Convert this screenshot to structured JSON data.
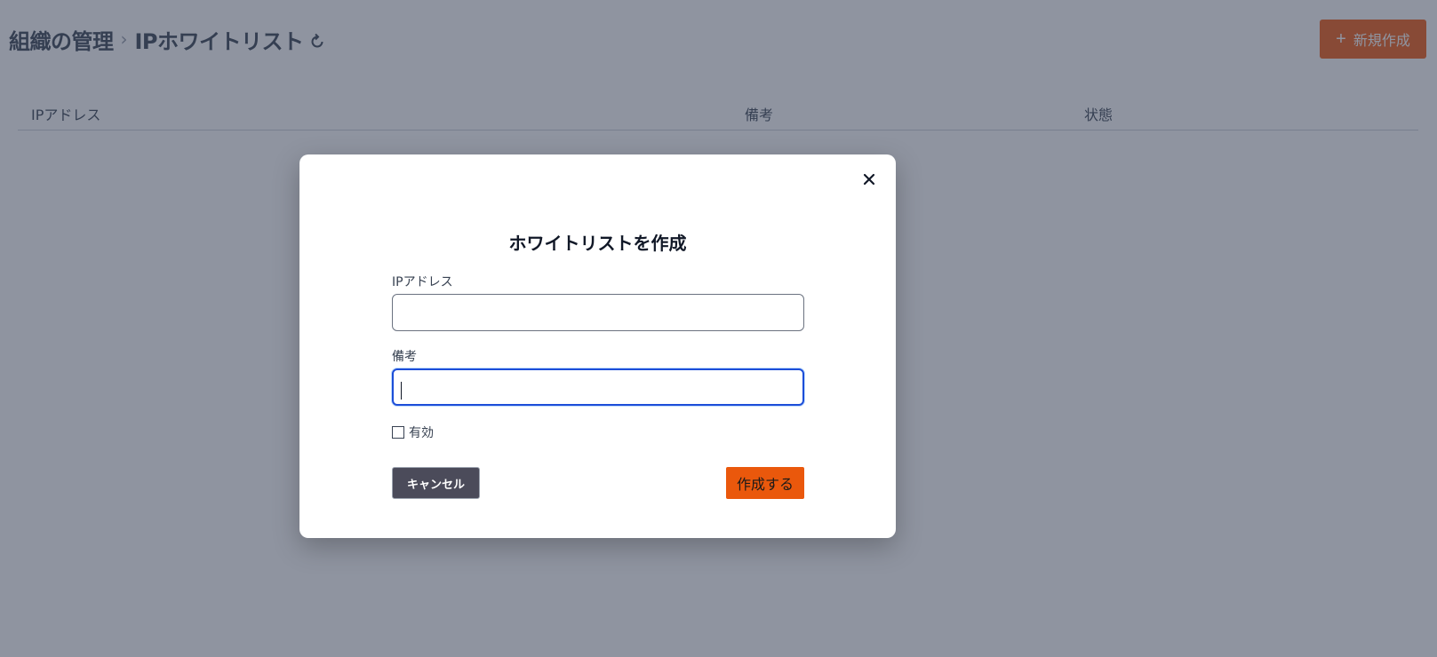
{
  "breadcrumb": {
    "parent": "組織の管理",
    "separator": "›",
    "current": "IPホワイトリスト"
  },
  "icons": {
    "refresh": "refresh-icon",
    "plus": "plus-icon",
    "close": "close-icon"
  },
  "new_button": {
    "plus": "+",
    "label": "新規作成"
  },
  "table": {
    "columns": [
      "IPアドレス",
      "備考",
      "状態"
    ]
  },
  "modal": {
    "title": "ホワイトリストを作成",
    "close_symbol": "×",
    "fields": {
      "ip_label": "IPアドレス",
      "ip_value": "",
      "note_label": "備考",
      "note_value": ""
    },
    "checkbox": {
      "label": "有効",
      "checked": false
    },
    "cancel_label": "キャンセル",
    "submit_label": "作成する"
  },
  "colors": {
    "accent": "#ea580c",
    "overlay": "rgba(31,41,65,0.5)",
    "focus_ring": "#1d4ed8",
    "cancel_bg": "#4b4b5a"
  }
}
